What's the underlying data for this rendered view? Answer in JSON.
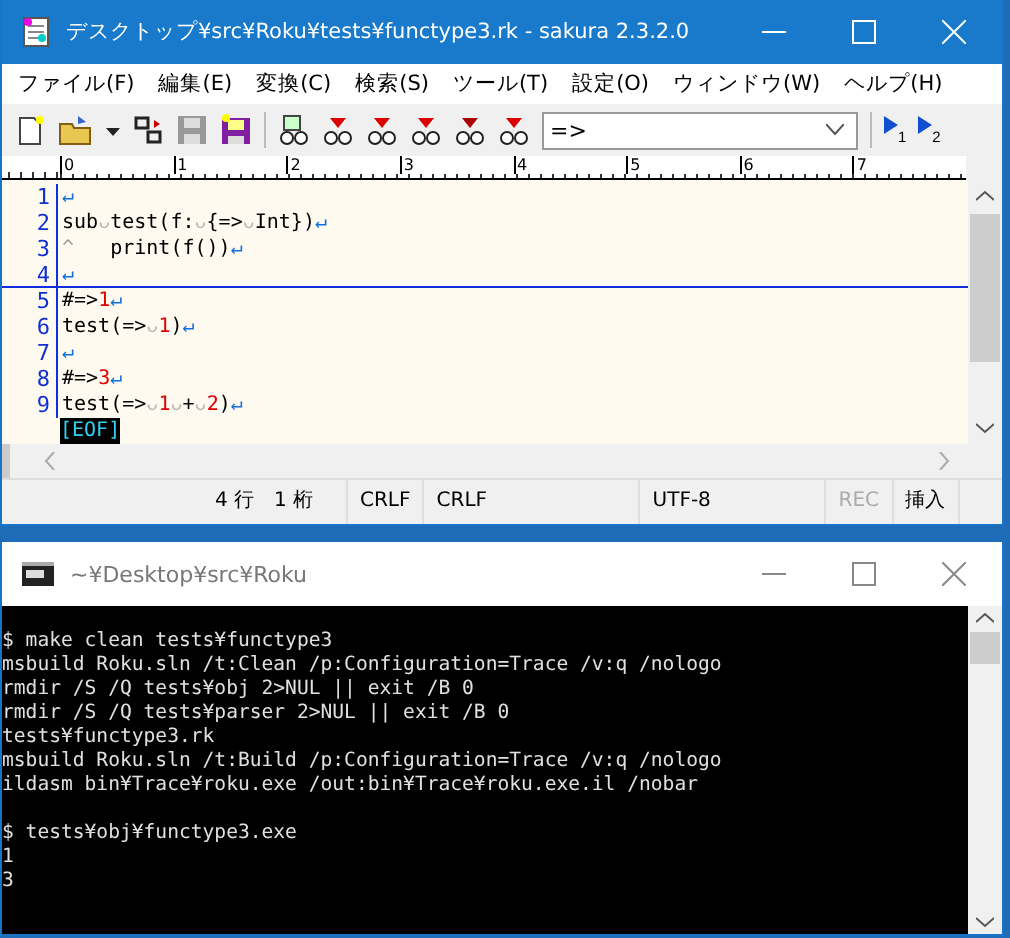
{
  "editor_window": {
    "title": "デスクトップ¥src¥Roku¥tests¥functype3.rk - sakura 2.3.2.0",
    "menu": [
      "ファイル(F)",
      "編集(E)",
      "変換(C)",
      "検索(S)",
      "ツール(T)",
      "設定(O)",
      "ウィンドウ(W)",
      "ヘルプ(H)"
    ],
    "toolbar": {
      "search_combo": {
        "value": "=>"
      },
      "jump_buttons": [
        "1",
        "2"
      ]
    },
    "ruler": [
      "0",
      "1",
      "2",
      "3",
      "4",
      "5",
      "6",
      "7"
    ],
    "lines": [
      {
        "number": "1",
        "current": false,
        "segments": [
          {
            "kind": "eol",
            "text": "↵"
          }
        ]
      },
      {
        "number": "2",
        "current": false,
        "segments": [
          {
            "kind": "code",
            "text": "sub"
          },
          {
            "kind": "space",
            "text": "ᴗ"
          },
          {
            "kind": "code",
            "text": "test(f:"
          },
          {
            "kind": "space",
            "text": "ᴗ"
          },
          {
            "kind": "code",
            "text": "{=>"
          },
          {
            "kind": "space",
            "text": "ᴗ"
          },
          {
            "kind": "code",
            "text": "Int})"
          },
          {
            "kind": "eol",
            "text": "↵"
          }
        ]
      },
      {
        "number": "3",
        "current": false,
        "segments": [
          {
            "kind": "tab",
            "text": "^"
          },
          {
            "kind": "code",
            "text": "   print(f())"
          },
          {
            "kind": "eol",
            "text": "↵"
          }
        ]
      },
      {
        "number": "4",
        "current": true,
        "segments": [
          {
            "kind": "eol",
            "text": "↵"
          }
        ]
      },
      {
        "number": "5",
        "current": false,
        "segments": [
          {
            "kind": "code",
            "text": "#=>"
          },
          {
            "kind": "number",
            "text": "1"
          },
          {
            "kind": "eol",
            "text": "↵"
          }
        ]
      },
      {
        "number": "6",
        "current": false,
        "segments": [
          {
            "kind": "code",
            "text": "test(=>"
          },
          {
            "kind": "space",
            "text": "ᴗ"
          },
          {
            "kind": "number",
            "text": "1"
          },
          {
            "kind": "code",
            "text": ")"
          },
          {
            "kind": "eol",
            "text": "↵"
          }
        ]
      },
      {
        "number": "7",
        "current": false,
        "segments": [
          {
            "kind": "eol",
            "text": "↵"
          }
        ]
      },
      {
        "number": "8",
        "current": false,
        "segments": [
          {
            "kind": "code",
            "text": "#=>"
          },
          {
            "kind": "number",
            "text": "3"
          },
          {
            "kind": "eol",
            "text": "↵"
          }
        ]
      },
      {
        "number": "9",
        "current": false,
        "segments": [
          {
            "kind": "code",
            "text": "test(=>"
          },
          {
            "kind": "space",
            "text": "ᴗ"
          },
          {
            "kind": "number",
            "text": "1"
          },
          {
            "kind": "space",
            "text": "ᴗ"
          },
          {
            "kind": "code",
            "text": "+"
          },
          {
            "kind": "space",
            "text": "ᴗ"
          },
          {
            "kind": "number",
            "text": "2"
          },
          {
            "kind": "code",
            "text": ")"
          },
          {
            "kind": "eol",
            "text": "↵"
          }
        ]
      }
    ],
    "eof": "[EOF]",
    "status_bar": [
      {
        "text": "4 行　1 桁",
        "disabled": false
      },
      {
        "text": "CRLF",
        "disabled": false
      },
      {
        "text": "CRLF",
        "disabled": false
      },
      {
        "text": "UTF-8",
        "disabled": false
      },
      {
        "text": "REC",
        "disabled": true
      },
      {
        "text": "挿入",
        "disabled": false
      }
    ]
  },
  "console_window": {
    "title": "~¥Desktop¥src¥Roku",
    "blocks": [
      [
        "$ make clean tests¥functype3",
        "msbuild Roku.sln /t:Clean /p:Configuration=Trace /v:q /nologo",
        "rmdir /S /Q tests¥obj 2>NUL || exit /B 0",
        "rmdir /S /Q tests¥parser 2>NUL || exit /B 0",
        "tests¥functype3.rk",
        "msbuild Roku.sln /t:Build /p:Configuration=Trace /v:q /nologo",
        "ildasm bin¥Trace¥roku.exe /out:bin¥Trace¥roku.exe.il /nobar"
      ],
      [
        "$ tests¥obj¥functype3.exe",
        "1",
        "3"
      ]
    ]
  }
}
